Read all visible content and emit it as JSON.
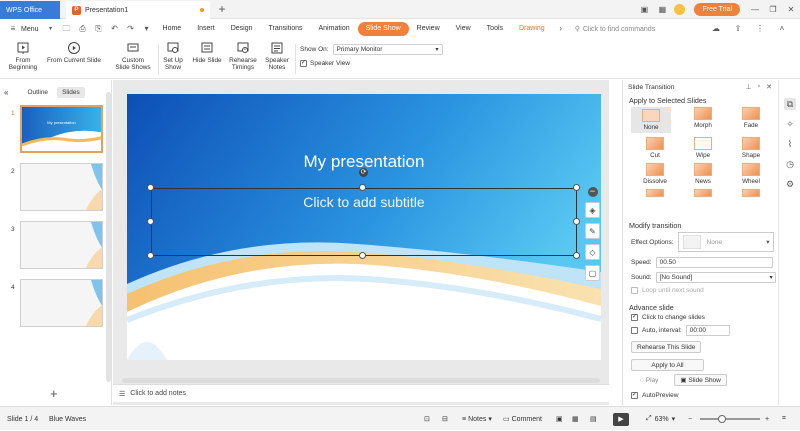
{
  "titlebar": {
    "app_tab": "WPS Office",
    "doc_tab": "Presentation1",
    "free_trial": "Free Trial"
  },
  "menubar": {
    "menu_label": "Menu",
    "tabs": [
      "Home",
      "Insert",
      "Design",
      "Transitions",
      "Animation",
      "Slide Show",
      "Review",
      "View",
      "Tools",
      "Drawing"
    ],
    "active_tab": "Slide Show",
    "search_placeholder": "Click to find commands"
  },
  "ribbon": {
    "from_beginning": "From\nBeginning",
    "from_current": "From Current Slide",
    "custom_shows": "Custom\nSlide Shows",
    "set_up_show": "Set Up\nShow",
    "hide_slide": "Hide Slide",
    "rehearse_timings": "Rehearse\nTimings",
    "speaker_notes": "Speaker\nNotes",
    "show_on_label": "Show On:",
    "show_on_value": "Primary Monitor",
    "speaker_view": "Speaker View"
  },
  "leftpanel": {
    "tab_outline": "Outline",
    "tab_slides": "Slides",
    "slides": [
      {
        "num": "1",
        "title": "My presentation"
      },
      {
        "num": "2",
        "title": ""
      },
      {
        "num": "3",
        "title": ""
      },
      {
        "num": "4",
        "title": ""
      }
    ]
  },
  "slide": {
    "title": "My presentation",
    "subtitle": "Click to add subtitle"
  },
  "notes_placeholder": "Click to add notes",
  "rightpanel": {
    "header": "Slide Transition",
    "apply_label": "Apply to Selected Slides",
    "transitions": [
      "None",
      "Morph",
      "Fade",
      "Cut",
      "Wipe",
      "Shape",
      "Dissolve",
      "News",
      "Wheel"
    ],
    "selected_transition": "None",
    "modify_label": "Modify transition",
    "effect_options_label": "Effect Options:",
    "effect_options_value": "None",
    "speed_label": "Speed:",
    "speed_value": "00.50",
    "sound_label": "Sound:",
    "sound_value": "[No Sound]",
    "loop_label": "Loop until next sound",
    "advance_label": "Advance slide",
    "click_change_label": "Click to change slides",
    "auto_interval_label": "Auto, interval:",
    "auto_interval_value": "00:00",
    "rehearse_button": "Rehearse This Slide",
    "apply_all_button": "Apply to All",
    "play_button": "Play",
    "slideshow_button": "Slide Show",
    "autopreview_label": "AutoPreview"
  },
  "statusbar": {
    "slide_counter": "Slide 1 / 4",
    "theme": "Blue Waves",
    "notes": "Notes",
    "comment": "Comment",
    "zoom": "63%"
  },
  "colors": {
    "accent": "#f0803a",
    "wps_blue": "#3a7bd5"
  }
}
